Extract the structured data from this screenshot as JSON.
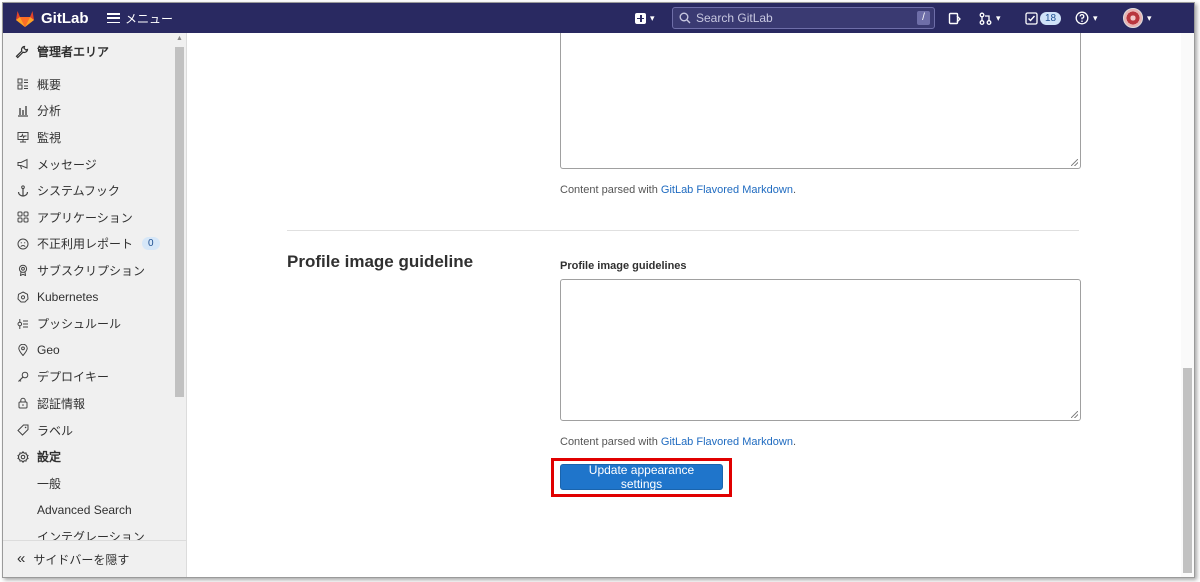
{
  "app": {
    "name": "GitLab"
  },
  "header": {
    "menu_label": "メニュー",
    "search_placeholder": "Search GitLab",
    "search_shortcut": "/",
    "todo_count": "18"
  },
  "sidebar": {
    "title": "管理者エリア",
    "items": [
      {
        "label": "概要",
        "icon": "overview-icon"
      },
      {
        "label": "分析",
        "icon": "analytics-icon"
      },
      {
        "label": "監視",
        "icon": "monitor-icon"
      },
      {
        "label": "メッセージ",
        "icon": "bullhorn-icon"
      },
      {
        "label": "システムフック",
        "icon": "anchor-icon"
      },
      {
        "label": "アプリケーション",
        "icon": "applications-icon"
      },
      {
        "label": "不正利用レポート",
        "icon": "abuse-icon",
        "count": "0"
      },
      {
        "label": "サブスクリプション",
        "icon": "subscription-icon"
      },
      {
        "label": "Kubernetes",
        "icon": "kubernetes-icon"
      },
      {
        "label": "プッシュルール",
        "icon": "push-rules-icon"
      },
      {
        "label": "Geo",
        "icon": "location-icon"
      },
      {
        "label": "デプロイキー",
        "icon": "key-icon"
      },
      {
        "label": "認証情報",
        "icon": "lock-icon"
      },
      {
        "label": "ラベル",
        "icon": "label-icon"
      },
      {
        "label": "設定",
        "icon": "settings-icon"
      }
    ],
    "sub_items": [
      "一般",
      "Advanced Search",
      "インテグレーション"
    ],
    "collapse_label": "サイドバーを隠す"
  },
  "main": {
    "hint_prefix": "Content parsed with ",
    "hint_link": "GitLab Flavored Markdown",
    "hint_suffix": ".",
    "section_title": "Profile image guideline",
    "field_label": "Profile image guidelines",
    "submit_label": "Update appearance settings"
  },
  "colors": {
    "header_bg": "#292961",
    "accent": "#1f75cb",
    "highlight": "#e00000"
  }
}
